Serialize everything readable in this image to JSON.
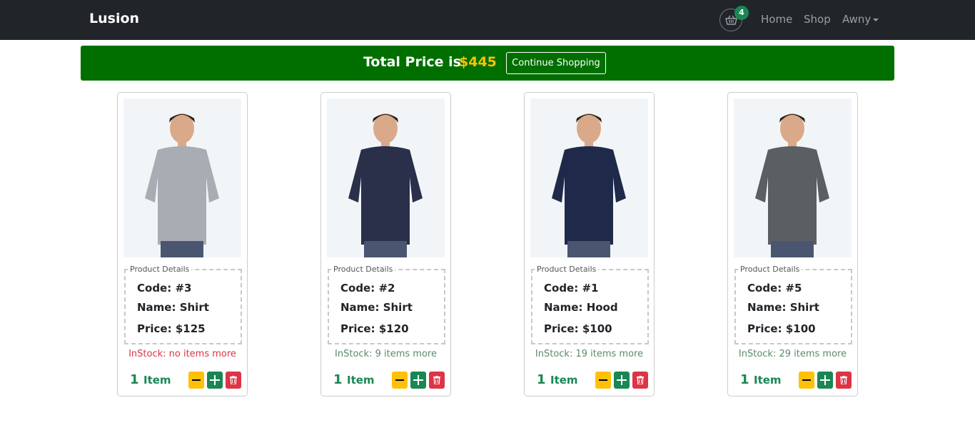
{
  "navbar": {
    "brand": "Lusion",
    "cart_count": "4",
    "links": [
      "Home",
      "Shop"
    ],
    "user": "Awny"
  },
  "banner": {
    "label": "Total Price is",
    "total": "$445",
    "continue_button": "Continue Shopping"
  },
  "products": [
    {
      "legend": "Product Details",
      "code": "Code: #3",
      "name": "Name: Shirt",
      "price": "Price: $125",
      "stock": "InStock: no items more",
      "in_stock": false,
      "qty": "1",
      "qty_label": "Item",
      "shirt_color": "#a9acb3"
    },
    {
      "legend": "Product Details",
      "code": "Code: #2",
      "name": "Name: Shirt",
      "price": "Price: $120",
      "stock": "InStock: 9 items more",
      "in_stock": true,
      "qty": "1",
      "qty_label": "Item",
      "shirt_color": "#2a2f4a"
    },
    {
      "legend": "Product Details",
      "code": "Code: #1",
      "name": "Name: Hood",
      "price": "Price: $100",
      "stock": "InStock: 19 items more",
      "in_stock": true,
      "qty": "1",
      "qty_label": "Item",
      "shirt_color": "#1f2a4a"
    },
    {
      "legend": "Product Details",
      "code": "Code: #5",
      "name": "Name: Shirt",
      "price": "Price: $100",
      "stock": "InStock: 29 items more",
      "in_stock": true,
      "qty": "1",
      "qty_label": "Item",
      "shirt_color": "#5b5e63"
    }
  ],
  "colors": {
    "navbar": "#212529",
    "banner": "#006f00",
    "total": "#ffc107",
    "success": "#198754",
    "danger": "#dc3545",
    "warning": "#ffc107"
  },
  "icons": {
    "cart": "basket-icon",
    "minus": "minus-icon",
    "plus": "plus-icon",
    "delete": "trash-icon"
  }
}
